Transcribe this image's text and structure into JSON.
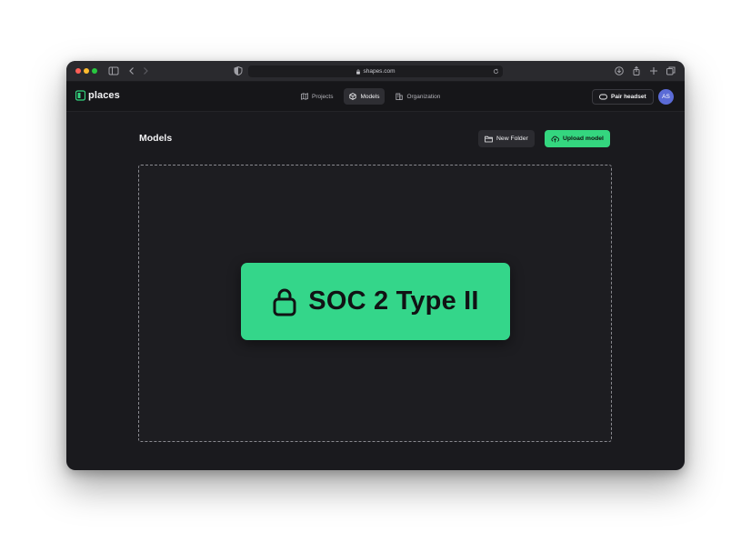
{
  "browser": {
    "url": "shapes.com"
  },
  "app": {
    "logo_text": "places",
    "nav": [
      {
        "label": "Projects",
        "icon": "map-icon",
        "active": false
      },
      {
        "label": "Models",
        "icon": "cube-icon",
        "active": true
      },
      {
        "label": "Organization",
        "icon": "building-icon",
        "active": false
      }
    ],
    "pair_headset_label": "Pair headset",
    "avatar_initials": "AS"
  },
  "main": {
    "title": "Models",
    "new_folder_label": "New Folder",
    "upload_label": "Upload model",
    "badge_text": "SOC 2 Type II"
  },
  "colors": {
    "accent": "#34d67f",
    "background": "#1a1a1e",
    "avatar": "#5b6bd6"
  }
}
